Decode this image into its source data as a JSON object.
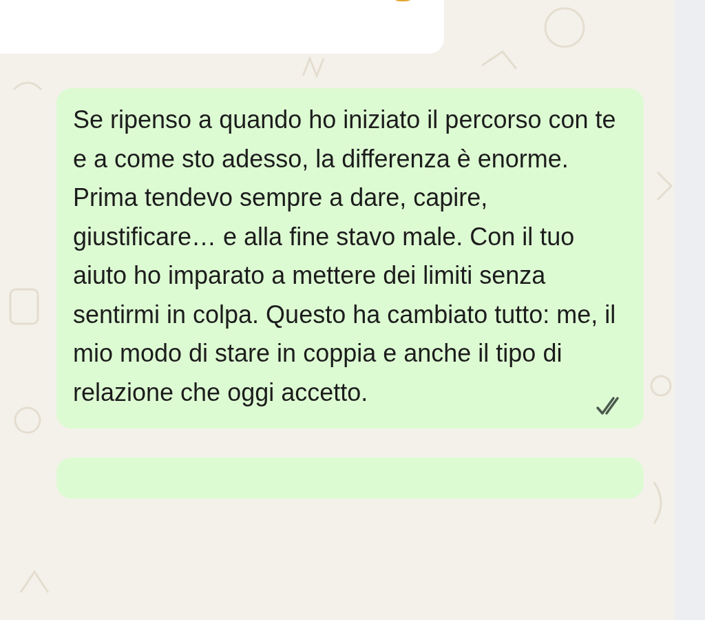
{
  "messages": [
    {
      "kind": "incoming",
      "has_emoji": true
    },
    {
      "kind": "outgoing",
      "text": "Se ripenso a quando ho iniziato il percorso con te e a come sto adesso, la differenza è enorme. Prima tendevo sempre a dare, capire, giustificare… e alla fine stavo male. Con il tuo aiuto ho imparato a mettere dei limiti senza sentirmi in colpa. Questo ha cambiato tutto: me, il mio modo di stare in coppia e anche il tipo di relazione che oggi accetto.",
      "read": false
    },
    {
      "kind": "outgoing"
    }
  ]
}
